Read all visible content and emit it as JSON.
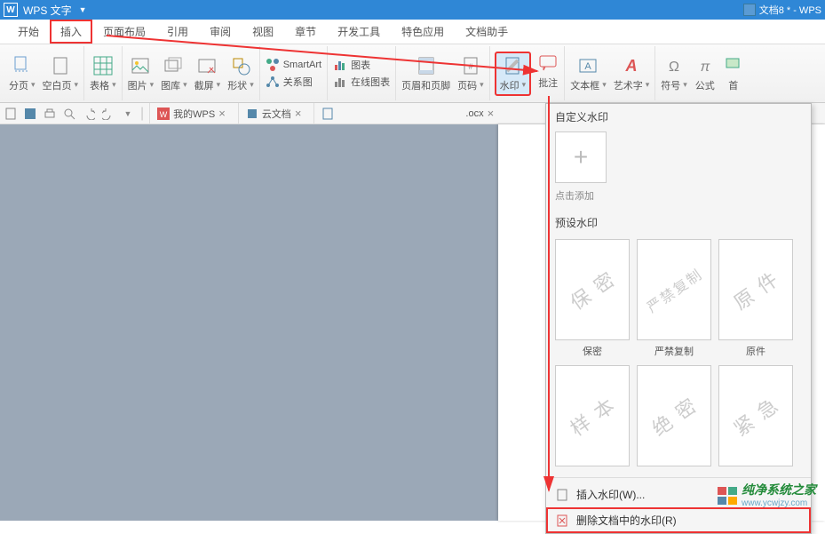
{
  "titlebar": {
    "app_name": "WPS 文字",
    "doc_title": "文档8 * - WPS"
  },
  "menu": {
    "start": "开始",
    "insert": "插入",
    "pagelayout": "页面布局",
    "reference": "引用",
    "review": "审阅",
    "view": "视图",
    "section": "章节",
    "devtools": "开发工具",
    "special": "特色应用",
    "dochelper": "文档助手"
  },
  "ribbon": {
    "pagebreak": "分页",
    "blankpage": "空白页",
    "table": "表格",
    "picture": "图片",
    "gallery": "图库",
    "screenshot": "截屏",
    "shape": "形状",
    "smartart": "SmartArt",
    "chart": "图表",
    "relation": "关系图",
    "onlinechart": "在线图表",
    "headerfooter": "页眉和页脚",
    "pagenumber": "页码",
    "watermark": "水印",
    "comment": "批注",
    "textbox": "文本框",
    "wordart": "艺术字",
    "symbol": "符号",
    "formula": "公式",
    "first": "首"
  },
  "qat_tabs": {
    "mywps": "我的WPS",
    "cloud": "云文档",
    "doc_ext": ".ocx"
  },
  "dropdown": {
    "custom_title": "自定义水印",
    "add_label": "点击添加",
    "preset_title": "预设水印",
    "presets": [
      {
        "text": "保 密",
        "label": "保密"
      },
      {
        "text": "严禁复制",
        "label": "严禁复制"
      },
      {
        "text": "原 件",
        "label": "原件"
      },
      {
        "text": "样 本",
        "label": ""
      },
      {
        "text": "绝 密",
        "label": ""
      },
      {
        "text": "紧 急",
        "label": ""
      }
    ],
    "insert_item": "插入水印(W)...",
    "delete_item": "删除文档中的水印(R)"
  },
  "brand": {
    "name": "纯净系统之家",
    "url": "www.ycwjzy.com"
  }
}
